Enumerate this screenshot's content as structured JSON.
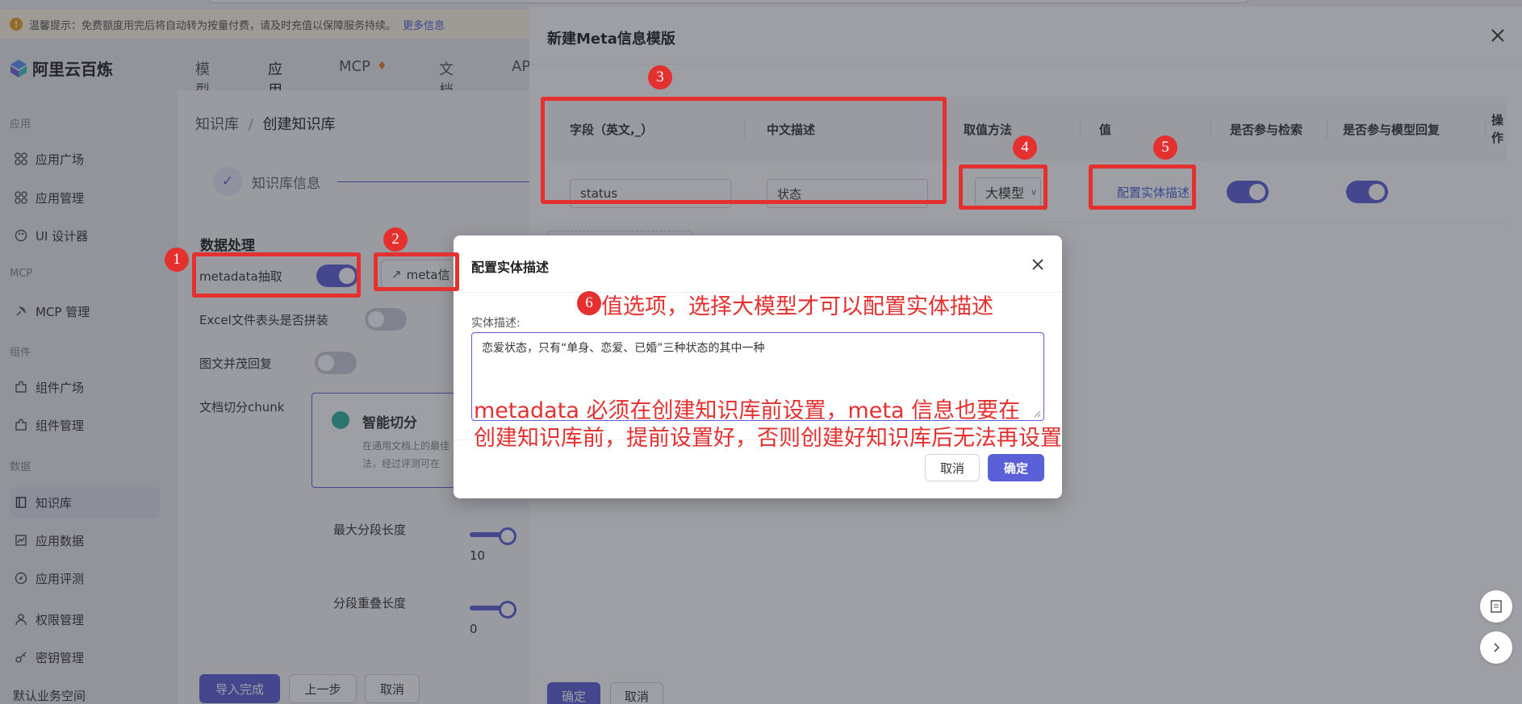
{
  "notice": {
    "text": "温馨提示：免费额度用完后将自动转为按量付费，请及时充值以保障服务持续。",
    "more_link": "更多信息"
  },
  "logo_text": "阿里云百炼",
  "top_nav": [
    "模型",
    "应用",
    "MCP",
    "文档",
    "AP"
  ],
  "sidebar": {
    "sections": {
      "app": "应用",
      "mcp": "MCP",
      "component": "组件",
      "data": "数据"
    },
    "items": {
      "app_square": "应用广场",
      "app_manage": "应用管理",
      "ui_designer": "UI 设计器",
      "mcp_manage": "MCP 管理",
      "comp_square": "组件广场",
      "comp_manage": "组件管理",
      "knowledge": "知识库",
      "app_data": "应用数据",
      "app_eval": "应用评测",
      "permission": "权限管理",
      "key_manage": "密钥管理",
      "workspace": "默认业务空间"
    }
  },
  "breadcrumb": {
    "root": "知识库",
    "sep": "/",
    "current": "创建知识库"
  },
  "stepper": {
    "step1": "知识库信息"
  },
  "data_processing": {
    "title": "数据处理",
    "metadata_label": "metadata抽取",
    "meta_button": "meta信",
    "excel_label": "Excel文件表头是否拼装",
    "image_text_label": "图文并茂回复",
    "chunk_label": "文档切分chunk",
    "chunk_card_title": "智能切分",
    "chunk_card_desc": "在通用文档上的最佳",
    "chunk_card_desc2": "法，经过评测可在",
    "max_len_label": "最大分段长度",
    "max_len_value": "10",
    "overlap_label": "分段重叠长度",
    "overlap_value": "0"
  },
  "bottom_buttons": {
    "import_done": "导入完成",
    "prev": "上一步",
    "cancel": "取消"
  },
  "drawer": {
    "title": "新建Meta信息模版",
    "columns": [
      "字段（英文,_）",
      "中文描述",
      "取值方法",
      "值",
      "是否参与检索",
      "是否参与模型回复",
      "操作"
    ],
    "row": {
      "field": "status",
      "desc": "状态",
      "method": "大模型",
      "value_link": "配置实体描述",
      "search_enabled": true,
      "reply_enabled": true
    },
    "confirm": "确定",
    "cancel": "取消"
  },
  "modal": {
    "title": "配置实体描述",
    "label": "实体描述:",
    "value": "恋爱状态，只有“单身、恋爱、已婚”三种状态的其中一种",
    "cancel": "取消",
    "confirm": "确定"
  },
  "annotations": {
    "marks": [
      "1",
      "2",
      "3",
      "4",
      "5",
      "6"
    ],
    "note6": "值选项，选择大模型才可以配置实体描述",
    "note_line1": "metadata 必须在创建知识库前设置，meta 信息也要在",
    "note_line2": "创建知识库前，提前设置好，否则创建好知识库后无法再设置"
  },
  "colors": {
    "accent": "#5b5fd8",
    "annotation": "#e53030",
    "link": "#4a5fd9"
  }
}
